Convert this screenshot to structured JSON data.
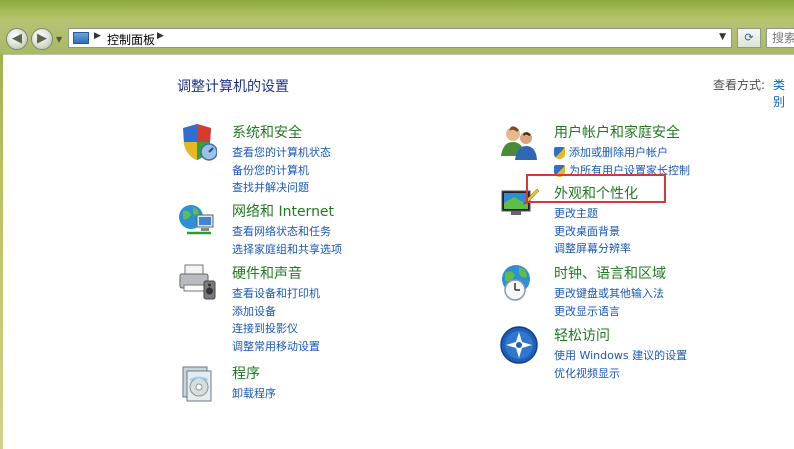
{
  "address": {
    "breadcrumb": "控制面板",
    "search_placeholder": "搜索"
  },
  "header": {
    "title": "调整计算机的设置",
    "view_by_label": "查看方式:",
    "view_by_value": "类别"
  },
  "categories": [
    {
      "title": "系统和安全",
      "icon": "system-security-icon",
      "links": [
        "查看您的计算机状态",
        "备份您的计算机",
        "查找并解决问题"
      ]
    },
    {
      "title": "网络和 Internet",
      "icon": "network-internet-icon",
      "links": [
        "查看网络状态和任务",
        "选择家庭组和共享选项"
      ]
    },
    {
      "title": "硬件和声音",
      "icon": "hardware-sound-icon",
      "links": [
        "查看设备和打印机",
        "添加设备",
        "连接到投影仪",
        "调整常用移动设置"
      ]
    },
    {
      "title": "程序",
      "icon": "programs-icon",
      "links": [
        "卸载程序"
      ]
    },
    {
      "title": "用户帐户和家庭安全",
      "icon": "user-accounts-icon",
      "links": [
        "添加或删除用户帐户",
        "为所有用户设置家长控制"
      ]
    },
    {
      "title": "外观和个性化",
      "icon": "appearance-personalization-icon",
      "links": [
        "更改主题",
        "更改桌面背景",
        "调整屏幕分辨率"
      ]
    },
    {
      "title": "时钟、语言和区域",
      "icon": "clock-language-region-icon",
      "links": [
        "更改键盘或其他输入法",
        "更改显示语言"
      ]
    },
    {
      "title": "轻松访问",
      "icon": "ease-of-access-icon",
      "links": [
        "使用 Windows 建议的设置",
        "优化视频显示"
      ]
    }
  ],
  "colors": {
    "category_title": "#1f7b1f",
    "link": "#1a58b8",
    "page_title": "#1e3287",
    "highlight": "#d23a3a"
  }
}
